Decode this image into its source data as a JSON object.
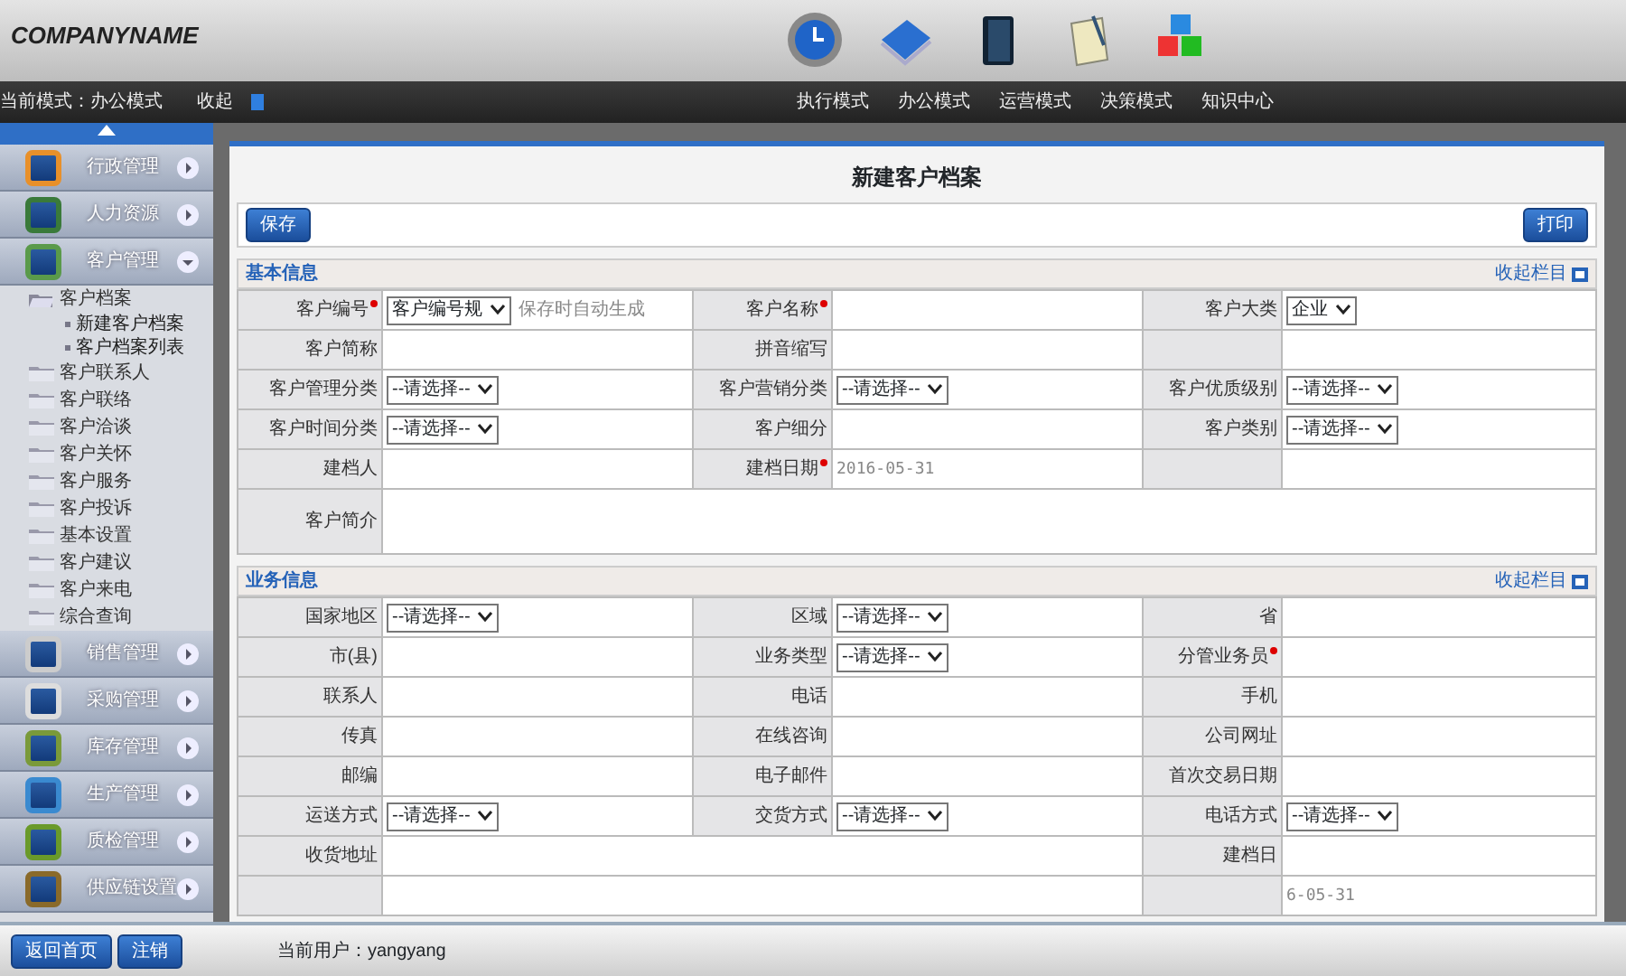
{
  "header": {
    "logo": "COMPANYNAME",
    "modes": [
      {
        "label": "执行模式"
      },
      {
        "label": "办公模式"
      },
      {
        "label": "运营模式"
      },
      {
        "label": "决策模式"
      },
      {
        "label": "知识中心"
      }
    ]
  },
  "modebar": {
    "current": "当前模式：办公模式",
    "collapse": "收起"
  },
  "sidebar": {
    "groups": [
      {
        "label": "行政管理",
        "expanded": false
      },
      {
        "label": "人力资源",
        "expanded": false
      },
      {
        "label": "客户管理",
        "expanded": true,
        "children": [
          {
            "label": "客户档案",
            "expanded": true,
            "children": [
              {
                "label": "新建客户档案"
              },
              {
                "label": "客户档案列表"
              }
            ]
          },
          {
            "label": "客户联系人",
            "expanded": false
          },
          {
            "label": "客户联络",
            "expanded": false
          },
          {
            "label": "客户洽谈",
            "expanded": false
          },
          {
            "label": "客户关怀",
            "expanded": false
          },
          {
            "label": "客户服务",
            "expanded": false
          },
          {
            "label": "客户投诉",
            "expanded": false
          },
          {
            "label": "基本设置",
            "expanded": false
          },
          {
            "label": "客户建议",
            "expanded": false
          },
          {
            "label": "客户来电",
            "expanded": false
          },
          {
            "label": "综合查询",
            "expanded": false
          }
        ]
      },
      {
        "label": "销售管理",
        "expanded": false
      },
      {
        "label": "采购管理",
        "expanded": false
      },
      {
        "label": "库存管理",
        "expanded": false
      },
      {
        "label": "生产管理",
        "expanded": false
      },
      {
        "label": "质检管理",
        "expanded": false
      },
      {
        "label": "供应链设置",
        "expanded": false
      }
    ]
  },
  "form": {
    "title": "新建客户档案",
    "save": "保存",
    "print": "打印",
    "sections": [
      {
        "title": "基本信息",
        "collapse": "收起栏目",
        "rows": [
          [
            {
              "kind": "label",
              "text": "客户编号",
              "required": true
            },
            {
              "kind": "select",
              "value": "客户编号规",
              "note": "保存时自动生成"
            },
            {
              "kind": "label",
              "text": "客户名称",
              "required": true
            },
            {
              "kind": "blank"
            },
            {
              "kind": "label",
              "text": "客户大类",
              "required": false
            },
            {
              "kind": "select",
              "value": "企业"
            }
          ],
          [
            {
              "kind": "label",
              "text": "客户简称",
              "required": false
            },
            {
              "kind": "blank"
            },
            {
              "kind": "label",
              "text": "拼音缩写",
              "required": false
            },
            {
              "kind": "blank"
            },
            {
              "kind": "gray"
            },
            {
              "kind": "blank"
            }
          ],
          [
            {
              "kind": "label",
              "text": "客户管理分类",
              "required": false
            },
            {
              "kind": "select",
              "value": "--请选择--"
            },
            {
              "kind": "label",
              "text": "客户营销分类",
              "required": false
            },
            {
              "kind": "select",
              "value": "--请选择--"
            },
            {
              "kind": "label",
              "text": "客户优质级别",
              "required": false
            },
            {
              "kind": "select",
              "value": "--请选择--"
            }
          ],
          [
            {
              "kind": "label",
              "text": "客户时间分类",
              "required": false
            },
            {
              "kind": "select",
              "value": "--请选择--"
            },
            {
              "kind": "label",
              "text": "客户细分",
              "required": false
            },
            {
              "kind": "blank"
            },
            {
              "kind": "label",
              "text": "客户类别",
              "required": false
            },
            {
              "kind": "select",
              "value": "--请选择--"
            }
          ],
          [
            {
              "kind": "label",
              "text": "建档人",
              "required": false
            },
            {
              "kind": "blank"
            },
            {
              "kind": "label",
              "text": "建档日期",
              "required": true
            },
            {
              "kind": "date",
              "text": "2016-05-31"
            },
            {
              "kind": "gray"
            },
            {
              "kind": "blank"
            }
          ],
          [
            {
              "kind": "label",
              "text": "客户简介",
              "required": false
            },
            {
              "kind": "textarea"
            },
            {
              "kind": "merged"
            },
            {
              "kind": "merged"
            },
            {
              "kind": "merged"
            },
            {
              "kind": "merged"
            }
          ]
        ]
      },
      {
        "title": "业务信息",
        "collapse": "收起栏目",
        "rows": [
          [
            {
              "kind": "label",
              "text": "国家地区",
              "required": false
            },
            {
              "kind": "select",
              "value": "--请选择--"
            },
            {
              "kind": "label",
              "text": "区域",
              "required": false
            },
            {
              "kind": "select",
              "value": "--请选择--"
            },
            {
              "kind": "label",
              "text": "省",
              "required": false
            },
            {
              "kind": "blank"
            }
          ],
          [
            {
              "kind": "label",
              "text": "市(县)",
              "required": false
            },
            {
              "kind": "blank"
            },
            {
              "kind": "label",
              "text": "业务类型",
              "required": false
            },
            {
              "kind": "select",
              "value": "--请选择--"
            },
            {
              "kind": "label",
              "text": "分管业务员",
              "required": true
            },
            {
              "kind": "blank"
            }
          ],
          [
            {
              "kind": "label",
              "text": "联系人",
              "required": false
            },
            {
              "kind": "blank"
            },
            {
              "kind": "label",
              "text": "电话",
              "required": false
            },
            {
              "kind": "blank"
            },
            {
              "kind": "label",
              "text": "手机",
              "required": false
            },
            {
              "kind": "blank"
            }
          ],
          [
            {
              "kind": "label",
              "text": "传真",
              "required": false
            },
            {
              "kind": "blank"
            },
            {
              "kind": "label",
              "text": "在线咨询",
              "required": false
            },
            {
              "kind": "blank"
            },
            {
              "kind": "label",
              "text": "公司网址",
              "required": false
            },
            {
              "kind": "blank"
            }
          ],
          [
            {
              "kind": "label",
              "text": "邮编",
              "required": false
            },
            {
              "kind": "blank"
            },
            {
              "kind": "label",
              "text": "电子邮件",
              "required": false
            },
            {
              "kind": "blank"
            },
            {
              "kind": "label",
              "text": "首次交易日期",
              "required": false
            },
            {
              "kind": "blank"
            }
          ],
          [
            {
              "kind": "label",
              "text": "运送方式",
              "required": false
            },
            {
              "kind": "select",
              "value": "--请选择--"
            },
            {
              "kind": "label",
              "text": "交货方式",
              "required": false
            },
            {
              "kind": "select",
              "value": "--请选择--"
            },
            {
              "kind": "label",
              "text": "电话方式",
              "required": false
            },
            {
              "kind": "select",
              "value": "--请选择--"
            }
          ],
          [
            {
              "kind": "label",
              "text": "收货地址",
              "required": false
            },
            {
              "kind": "wide"
            },
            {
              "kind": "merged"
            },
            {
              "kind": "merged"
            },
            {
              "kind": "label",
              "text": "建档日",
              "required": false
            },
            {
              "kind": "blank"
            }
          ],
          [
            {
              "kind": "gray"
            },
            {
              "kind": "wide"
            },
            {
              "kind": "merged"
            },
            {
              "kind": "merged"
            },
            {
              "kind": "gray"
            },
            {
              "kind": "date",
              "text": "6-05-31"
            }
          ]
        ]
      }
    ]
  },
  "footer": {
    "home": "返回首页",
    "logout": "注销",
    "user": "当前用户：yangyang"
  }
}
